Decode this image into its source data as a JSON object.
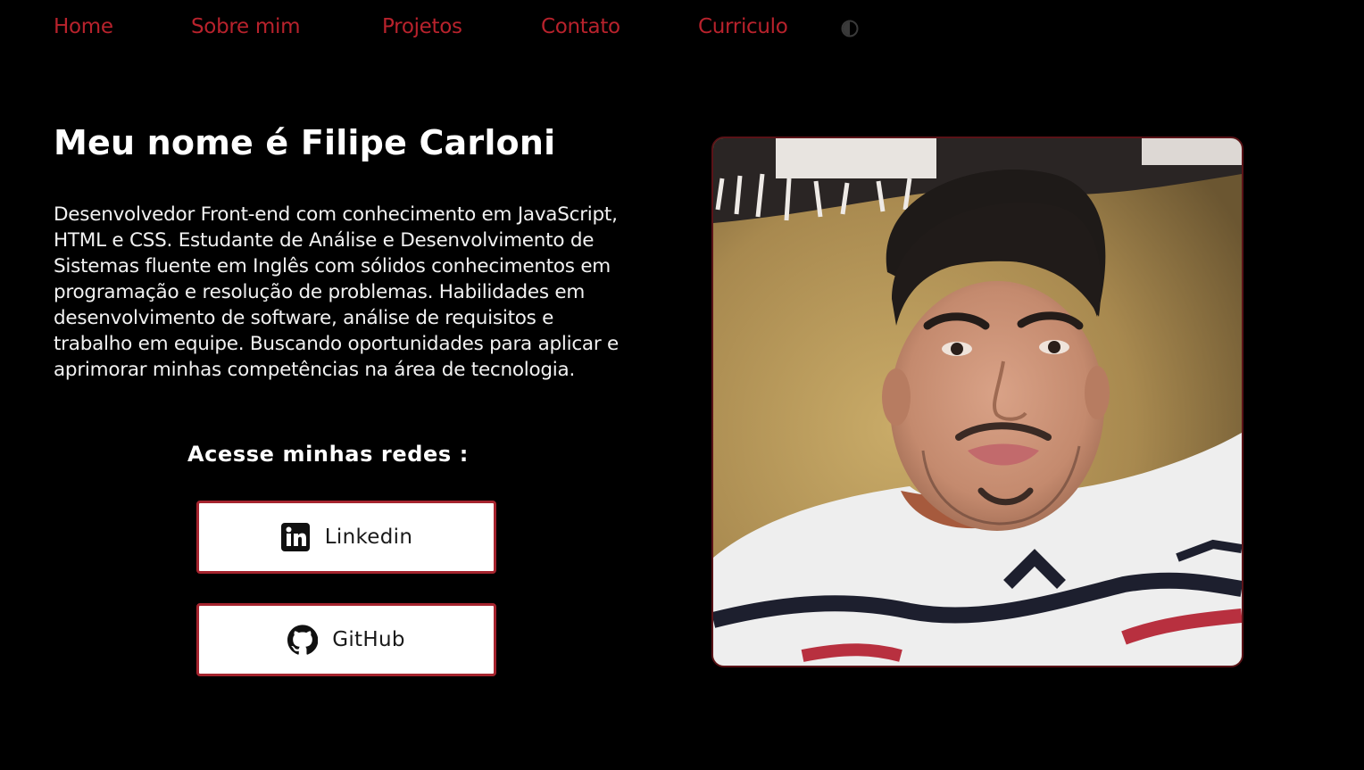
{
  "nav": {
    "items": [
      {
        "label": "Home"
      },
      {
        "label": "Sobre mim"
      },
      {
        "label": "Projetos"
      },
      {
        "label": "Contato"
      },
      {
        "label": "Curriculo"
      }
    ],
    "theme_toggle_icon": "half-circle-contrast-icon"
  },
  "hero": {
    "title": "Meu nome é Filipe Carloni",
    "bio": "Desenvolvedor Front-end com conhecimento em JavaScript, HTML e CSS. Estudante de Análise e Desenvolvimento de Sistemas fluente em Inglês com sólidos conhecimentos em programação e resolução de problemas. Habilidades em desenvolvimento de software, análise de requisitos e trabalho em equipe. Buscando oportunidades para aplicar e aprimorar minhas competências na área de tecnologia.",
    "socials_title": "Acesse minhas redes :",
    "socials": [
      {
        "label": "Linkedin",
        "icon": "linkedin-icon"
      },
      {
        "label": "GitHub",
        "icon": "github-icon"
      }
    ],
    "photo_icon": "profile-photo"
  },
  "colors": {
    "background": "#000000",
    "accent": "#b8222c",
    "button_border": "#a5242e",
    "text": "#ffffff"
  }
}
